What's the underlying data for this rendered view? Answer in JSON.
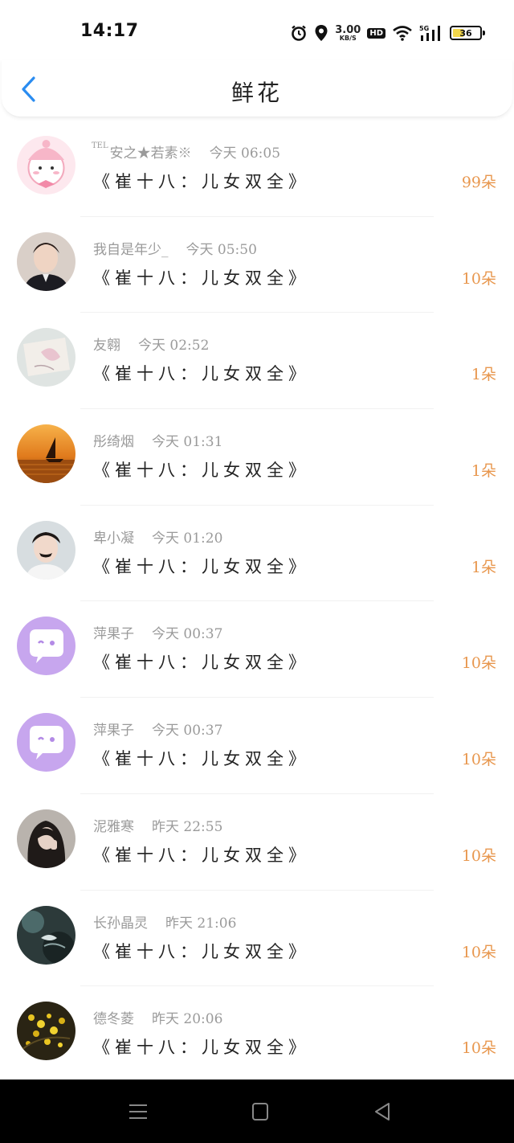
{
  "status": {
    "time": "14:17",
    "net_speed_value": "3.00",
    "net_speed_unit": "KB/S",
    "hd": "HD",
    "network": "5G",
    "battery": "36",
    "battery_level": 0.36,
    "icons": [
      "alarm-icon",
      "location-icon",
      "hd-icon",
      "wifi-icon",
      "signal-icon",
      "battery-icon"
    ]
  },
  "header": {
    "title": "鲜花"
  },
  "colors": {
    "accent": "#2a8cf0",
    "count": "#e8974e",
    "meta": "#9a9a9a"
  },
  "items": [
    {
      "tel": "TEL",
      "name": "安之★若素※",
      "time": "今天 06:05",
      "book": "《崔十八：儿女双全》",
      "count": "99朵"
    },
    {
      "tel": "",
      "name": "我自是年少_",
      "time": "今天 05:50",
      "book": "《崔十八：儿女双全》",
      "count": "10朵"
    },
    {
      "tel": "",
      "name": "友翱",
      "time": "今天 02:52",
      "book": "《崔十八：儿女双全》",
      "count": "1朵"
    },
    {
      "tel": "",
      "name": "彤绮烟",
      "time": "今天 01:31",
      "book": "《崔十八：儿女双全》",
      "count": "1朵"
    },
    {
      "tel": "",
      "name": "卑小凝",
      "time": "今天 01:20",
      "book": "《崔十八：儿女双全》",
      "count": "1朵"
    },
    {
      "tel": "",
      "name": "萍果子",
      "time": "今天 00:37",
      "book": "《崔十八：儿女双全》",
      "count": "10朵"
    },
    {
      "tel": "",
      "name": "萍果子",
      "time": "今天 00:37",
      "book": "《崔十八：儿女双全》",
      "count": "10朵"
    },
    {
      "tel": "",
      "name": "泥雅寒",
      "time": "昨天 22:55",
      "book": "《崔十八：儿女双全》",
      "count": "10朵"
    },
    {
      "tel": "",
      "name": "长孙晶灵",
      "time": "昨天 21:06",
      "book": "《崔十八：儿女双全》",
      "count": "10朵"
    },
    {
      "tel": "",
      "name": "德冬菱",
      "time": "昨天 20:06",
      "book": "《崔十八：儿女双全》",
      "count": "10朵"
    }
  ],
  "navbar": {
    "buttons": [
      "menu-icon",
      "home-icon",
      "back-triangle-icon"
    ]
  }
}
